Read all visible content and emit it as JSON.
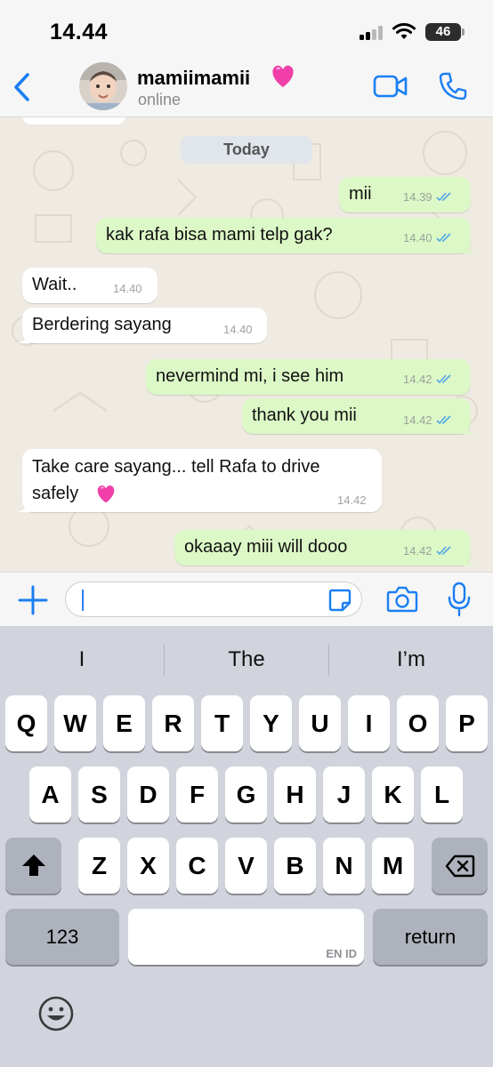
{
  "status_bar": {
    "time": "14.44",
    "battery": "46",
    "icons": [
      "cellular-signal-icon",
      "wifi-icon",
      "battery-icon"
    ]
  },
  "header": {
    "contact_name": "mamiimamii",
    "contact_emoji": "💗",
    "status": "online",
    "icons": [
      "chevron-left-icon",
      "video-call-icon",
      "phone-icon"
    ],
    "accent_color": "#1a7ff3"
  },
  "chat": {
    "date_label": "Today",
    "messages": [
      {
        "direction": "out",
        "text": "mii",
        "time": "14.39",
        "read": true
      },
      {
        "direction": "out",
        "text": "kak rafa bisa mami telp gak?",
        "time": "14.40",
        "read": true
      },
      {
        "direction": "in",
        "text": "Wait..",
        "time": "14.40"
      },
      {
        "direction": "in",
        "text": "Berdering sayang",
        "time": "14.40"
      },
      {
        "direction": "out",
        "text": "nevermind mi, i see him",
        "time": "14.42",
        "read": true
      },
      {
        "direction": "out",
        "text": "thank you mii",
        "time": "14.42",
        "read": true
      },
      {
        "direction": "in",
        "text": "Take care sayang... tell Rafa to drive",
        "text_line2": "safely",
        "emoji": "💗",
        "time": "14.42"
      },
      {
        "direction": "out",
        "text": "okaaay miii will dooo",
        "time": "14.42",
        "read": true
      }
    ],
    "colors": {
      "outgoing": "#dcf8c6",
      "incoming": "#ffffff",
      "read_ticks": "#4fa6e8",
      "wallpaper": "#efeae2"
    }
  },
  "input_bar": {
    "value": "",
    "icons": [
      "plus-icon",
      "sticker-icon",
      "camera-icon",
      "microphone-icon"
    ]
  },
  "keyboard": {
    "suggestions": [
      "I",
      "The",
      "I’m"
    ],
    "row1": [
      "Q",
      "W",
      "E",
      "R",
      "T",
      "Y",
      "U",
      "I",
      "O",
      "P"
    ],
    "row2": [
      "A",
      "S",
      "D",
      "F",
      "G",
      "H",
      "J",
      "K",
      "L"
    ],
    "row3": [
      "Z",
      "X",
      "C",
      "V",
      "B",
      "N",
      "M"
    ],
    "numbers_key": "123",
    "space_language": "EN ID",
    "return_key": "return",
    "icons": [
      "shift-icon",
      "backspace-icon",
      "emoji-icon"
    ]
  }
}
